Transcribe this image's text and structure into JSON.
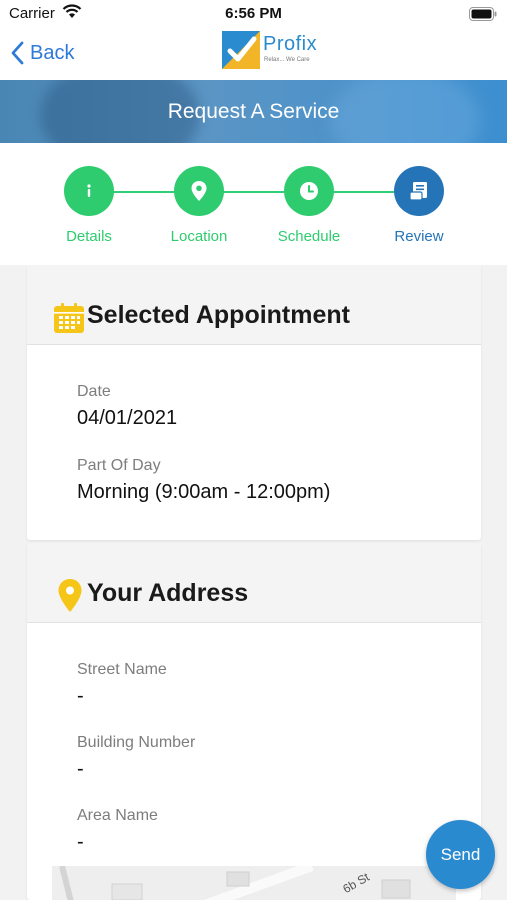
{
  "status_bar": {
    "carrier": "Carrier",
    "time": "6:56 PM"
  },
  "nav": {
    "back_label": "Back",
    "logo": {
      "name": "Profix",
      "tagline": "Relax... We Care"
    }
  },
  "hero": {
    "title": "Request A Service"
  },
  "stepper": {
    "steps": [
      {
        "label": "Details",
        "icon": "info-icon",
        "state": "done"
      },
      {
        "label": "Location",
        "icon": "location-pin-icon",
        "state": "done"
      },
      {
        "label": "Schedule",
        "icon": "clock-icon",
        "state": "done"
      },
      {
        "label": "Review",
        "icon": "receipt-icon",
        "state": "active"
      }
    ],
    "colors": {
      "done": "#2ecc6f",
      "active": "#2574b8"
    }
  },
  "appointment": {
    "title": "Selected Appointment",
    "icon": "calendar-icon",
    "date_label": "Date",
    "date_value": "04/01/2021",
    "part_of_day_label": "Part Of Day",
    "part_of_day_value": "Morning (9:00am - 12:00pm)"
  },
  "address": {
    "title": "Your Address",
    "icon": "location-pin-icon",
    "street_label": "Street Name",
    "street_value": "-",
    "building_label": "Building Number",
    "building_value": "-",
    "area_label": "Area Name",
    "area_value": "-"
  },
  "map": {
    "street_text": "6b St"
  },
  "send_label": "Send",
  "colors": {
    "accent": "#2a8ad0",
    "success": "#2ecc6f",
    "icon_yellow": "#f5c518"
  }
}
